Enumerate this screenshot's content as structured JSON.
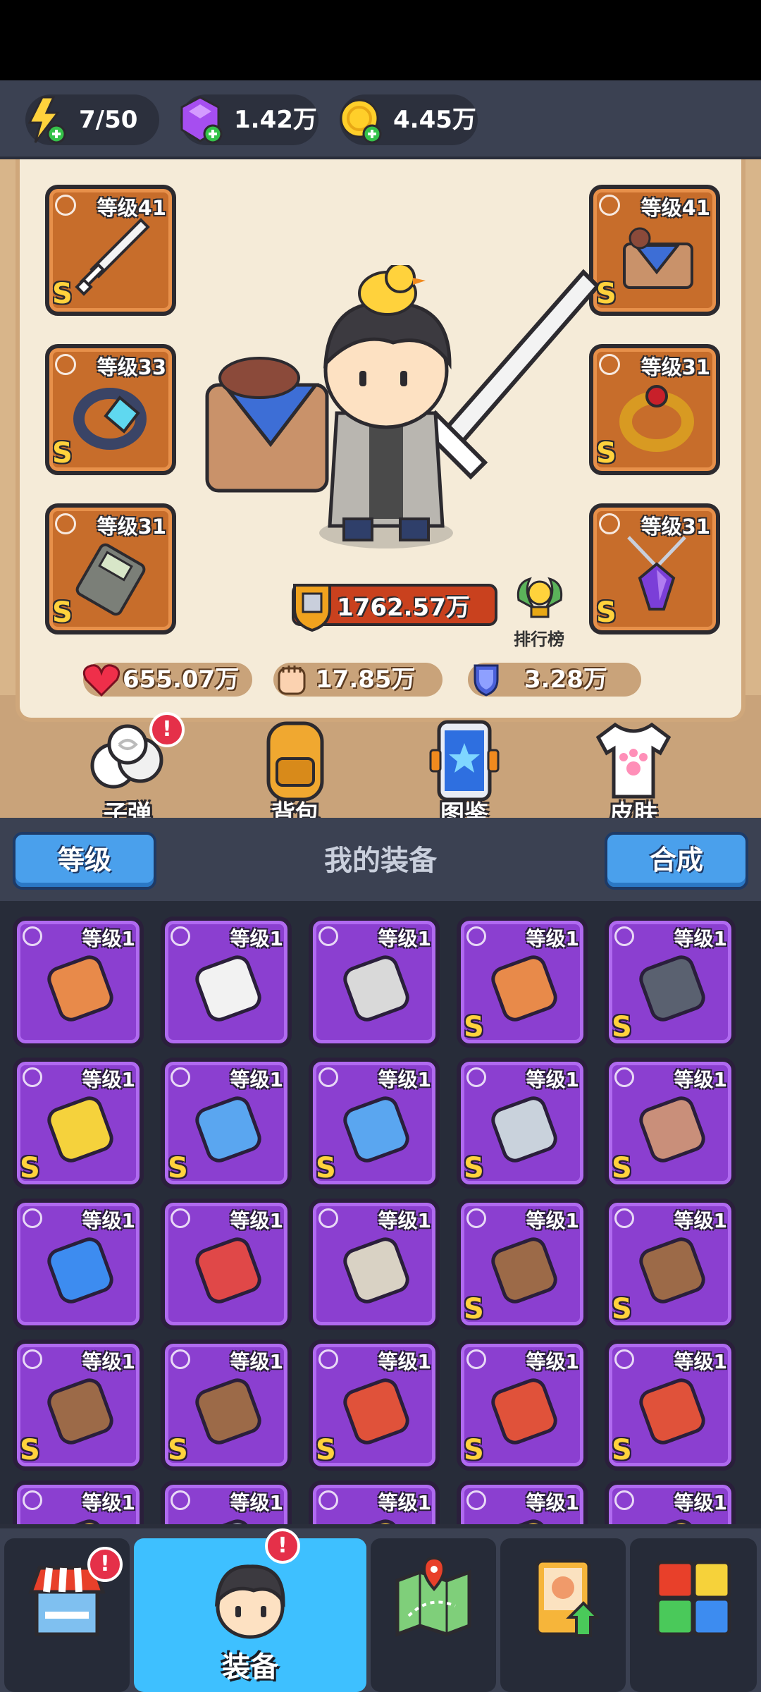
{
  "resources": {
    "energy": {
      "value": "7/50",
      "icon": "lightning-icon"
    },
    "gems": {
      "value": "1.42万",
      "icon": "gem-icon"
    },
    "coins": {
      "value": "4.45万",
      "icon": "coin-icon"
    }
  },
  "equipped": {
    "left": [
      {
        "level": "等级41",
        "grade": "S",
        "icon": "sword-icon"
      },
      {
        "level": "等级33",
        "grade": "S",
        "icon": "ring-icon"
      },
      {
        "level": "等级31",
        "grade": "S",
        "icon": "device-icon"
      }
    ],
    "right": [
      {
        "level": "等级41",
        "grade": "S",
        "icon": "basket-icon"
      },
      {
        "level": "等级31",
        "grade": "S",
        "icon": "gold-ring-icon"
      },
      {
        "level": "等级31",
        "grade": "S",
        "icon": "amulet-icon"
      }
    ]
  },
  "power": {
    "value": "1762.57万"
  },
  "ranking": {
    "label": "排行榜"
  },
  "stats": {
    "hp": "655.07万",
    "attack": "17.85万",
    "defense": "3.28万"
  },
  "shortcuts": {
    "bullets": "子弹",
    "backpack": "背包",
    "codex": "图鉴",
    "skin": "皮肤",
    "badge": "!"
  },
  "equipment_header": {
    "level_button": "等级",
    "title": "我的装备",
    "merge_button": "合成"
  },
  "inventory": {
    "items": [
      {
        "level": "等级1",
        "grade": "",
        "icon": "flask-icon",
        "color": "#e88a4a"
      },
      {
        "level": "等级1",
        "grade": "",
        "icon": "paper-icon",
        "color": "#f2f2f2"
      },
      {
        "level": "等级1",
        "grade": "",
        "icon": "newspaper-icon",
        "color": "#d9d9d9"
      },
      {
        "level": "等级1",
        "grade": "S",
        "icon": "bottle-icon",
        "color": "#e88a4a"
      },
      {
        "level": "等级1",
        "grade": "S",
        "icon": "gameconsole-icon",
        "color": "#5a6170"
      },
      {
        "level": "等级1",
        "grade": "S",
        "icon": "crown-icon",
        "color": "#f5d23c"
      },
      {
        "level": "等级1",
        "grade": "S",
        "icon": "shield-icon",
        "color": "#5aa6f0"
      },
      {
        "level": "等级1",
        "grade": "S",
        "icon": "shield-icon",
        "color": "#5aa6f0"
      },
      {
        "level": "等级1",
        "grade": "S",
        "icon": "hammer-icon",
        "color": "#c9d2dc"
      },
      {
        "level": "等级1",
        "grade": "S",
        "icon": "mushroom-icon",
        "color": "#c98f7a"
      },
      {
        "level": "等级1",
        "grade": "",
        "icon": "basket-icon",
        "color": "#3d8cf0"
      },
      {
        "level": "等级1",
        "grade": "",
        "icon": "firstaid-icon",
        "color": "#e04848"
      },
      {
        "level": "等级1",
        "grade": "",
        "icon": "box-icon",
        "color": "#d9d2c4"
      },
      {
        "level": "等级1",
        "grade": "S",
        "icon": "bag-icon",
        "color": "#9c6a48"
      },
      {
        "level": "等级1",
        "grade": "S",
        "icon": "bag-icon",
        "color": "#9c6a48"
      },
      {
        "level": "等级1",
        "grade": "S",
        "icon": "bag-icon",
        "color": "#9c6a48"
      },
      {
        "level": "等级1",
        "grade": "S",
        "icon": "bag-icon",
        "color": "#9c6a48"
      },
      {
        "level": "等级1",
        "grade": "S",
        "icon": "redbag-icon",
        "color": "#e0523a"
      },
      {
        "level": "等级1",
        "grade": "S",
        "icon": "redbag-icon",
        "color": "#e0523a"
      },
      {
        "level": "等级1",
        "grade": "S",
        "icon": "redbag-icon",
        "color": "#e0523a"
      },
      {
        "level": "等级1",
        "grade": "",
        "icon": "ring-icon",
        "color": "#c9a33c"
      },
      {
        "level": "等级1",
        "grade": "",
        "icon": "ring-icon",
        "color": "#8a8fa0"
      },
      {
        "level": "等级1",
        "grade": "",
        "icon": "ring-icon",
        "color": "#c9a33c"
      },
      {
        "level": "等级1",
        "grade": "",
        "icon": "ring-icon",
        "color": "#c9a33c"
      },
      {
        "level": "等级1",
        "grade": "",
        "icon": "ring-icon",
        "color": "#c9a33c"
      }
    ]
  },
  "bottom_nav": {
    "shop": {
      "label": "",
      "badge": "!"
    },
    "equipment": {
      "label": "装备",
      "badge": "!"
    },
    "map": {
      "label": ""
    },
    "quests": {
      "label": ""
    },
    "puzzle": {
      "label": ""
    }
  }
}
